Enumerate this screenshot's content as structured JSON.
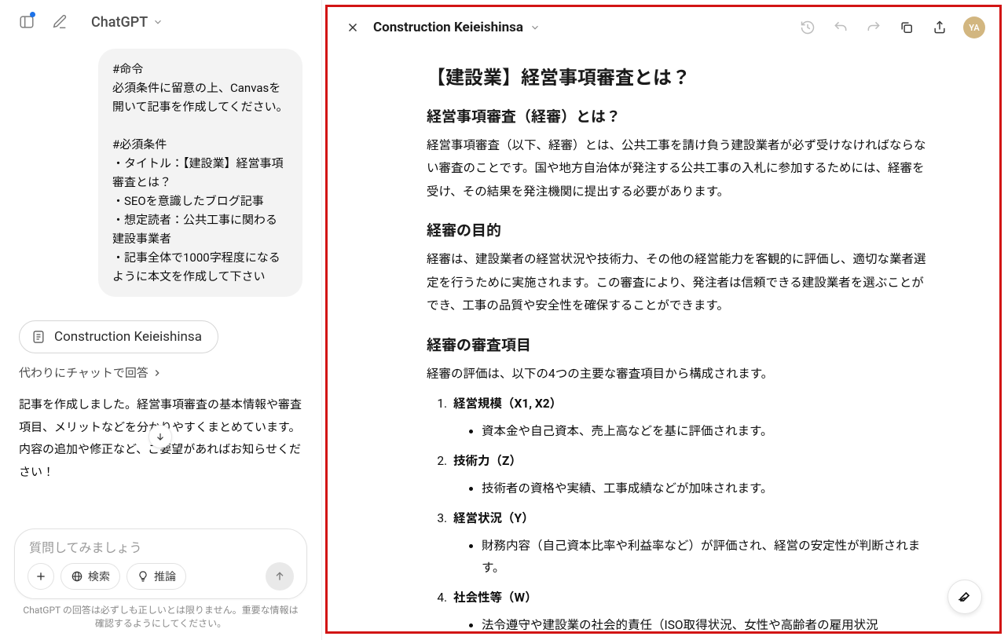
{
  "header": {
    "model_name": "ChatGPT"
  },
  "chat": {
    "user_message": "#命令\n必須条件に留意の上、Canvasを開いて記事を作成してください。\n\n#必須条件\n・タイトル：【建設業】経営事項審査とは？\n・SEOを意識したブログ記事\n・想定読者：公共工事に関わる建設事業者\n・記事全体で1000字程度になるように本文を作成して下さい",
    "canvas_ref_label": "Construction Keieishinsa",
    "reply_in_chat_label": "代わりにチャットで回答",
    "assistant_message": "記事を作成しました。経営事項審査の基本情報や審査項目、メリットなどを分かりやすくまとめています。内容の追加や修正など、ご要望があればお知らせください！"
  },
  "composer": {
    "placeholder": "質問してみましょう",
    "search_label": "検索",
    "reason_label": "推論"
  },
  "disclaimer": "ChatGPT の回答は必ずしも正しいとは限りません。重要な情報は確認するようにしてください。",
  "canvas": {
    "title": "Construction Keieishinsa",
    "avatar_initials": "YA",
    "doc": {
      "h1": "【建設業】経営事項審査とは？",
      "s1_h2": "経営事項審査（経審）とは？",
      "s1_p": "経営事項審査（以下、経審）とは、公共工事を請け負う建設業者が必ず受けなければならない審査のことです。国や地方自治体が発注する公共工事の入札に参加するためには、経審を受け、その結果を発注機関に提出する必要があります。",
      "s2_h2": "経審の目的",
      "s2_p": "経審は、建設業者の経営状況や技術力、その他の経営能力を客観的に評価し、適切な業者選定を行うために実施されます。この審査により、発注者は信頼できる建設業者を選ぶことができ、工事の品質や安全性を確保することができます。",
      "s3_h2": "経審の審査項目",
      "s3_p": "経審の評価は、以下の4つの主要な審査項目から構成されます。",
      "items": [
        {
          "title": "経営規模（X1, X2）",
          "detail": "資本金や自己資本、売上高などを基に評価されます。"
        },
        {
          "title": "技術力（Z）",
          "detail": "技術者の資格や実績、工事成績などが加味されます。"
        },
        {
          "title": "経営状況（Y）",
          "detail": "財務内容（自己資本比率や利益率など）が評価され、経営の安定性が判断されます。"
        },
        {
          "title": "社会性等（W）",
          "detail": "法令遵守や建設業の社会的責任（ISO取得状況、女性や高齢者の雇用状況"
        }
      ]
    }
  }
}
